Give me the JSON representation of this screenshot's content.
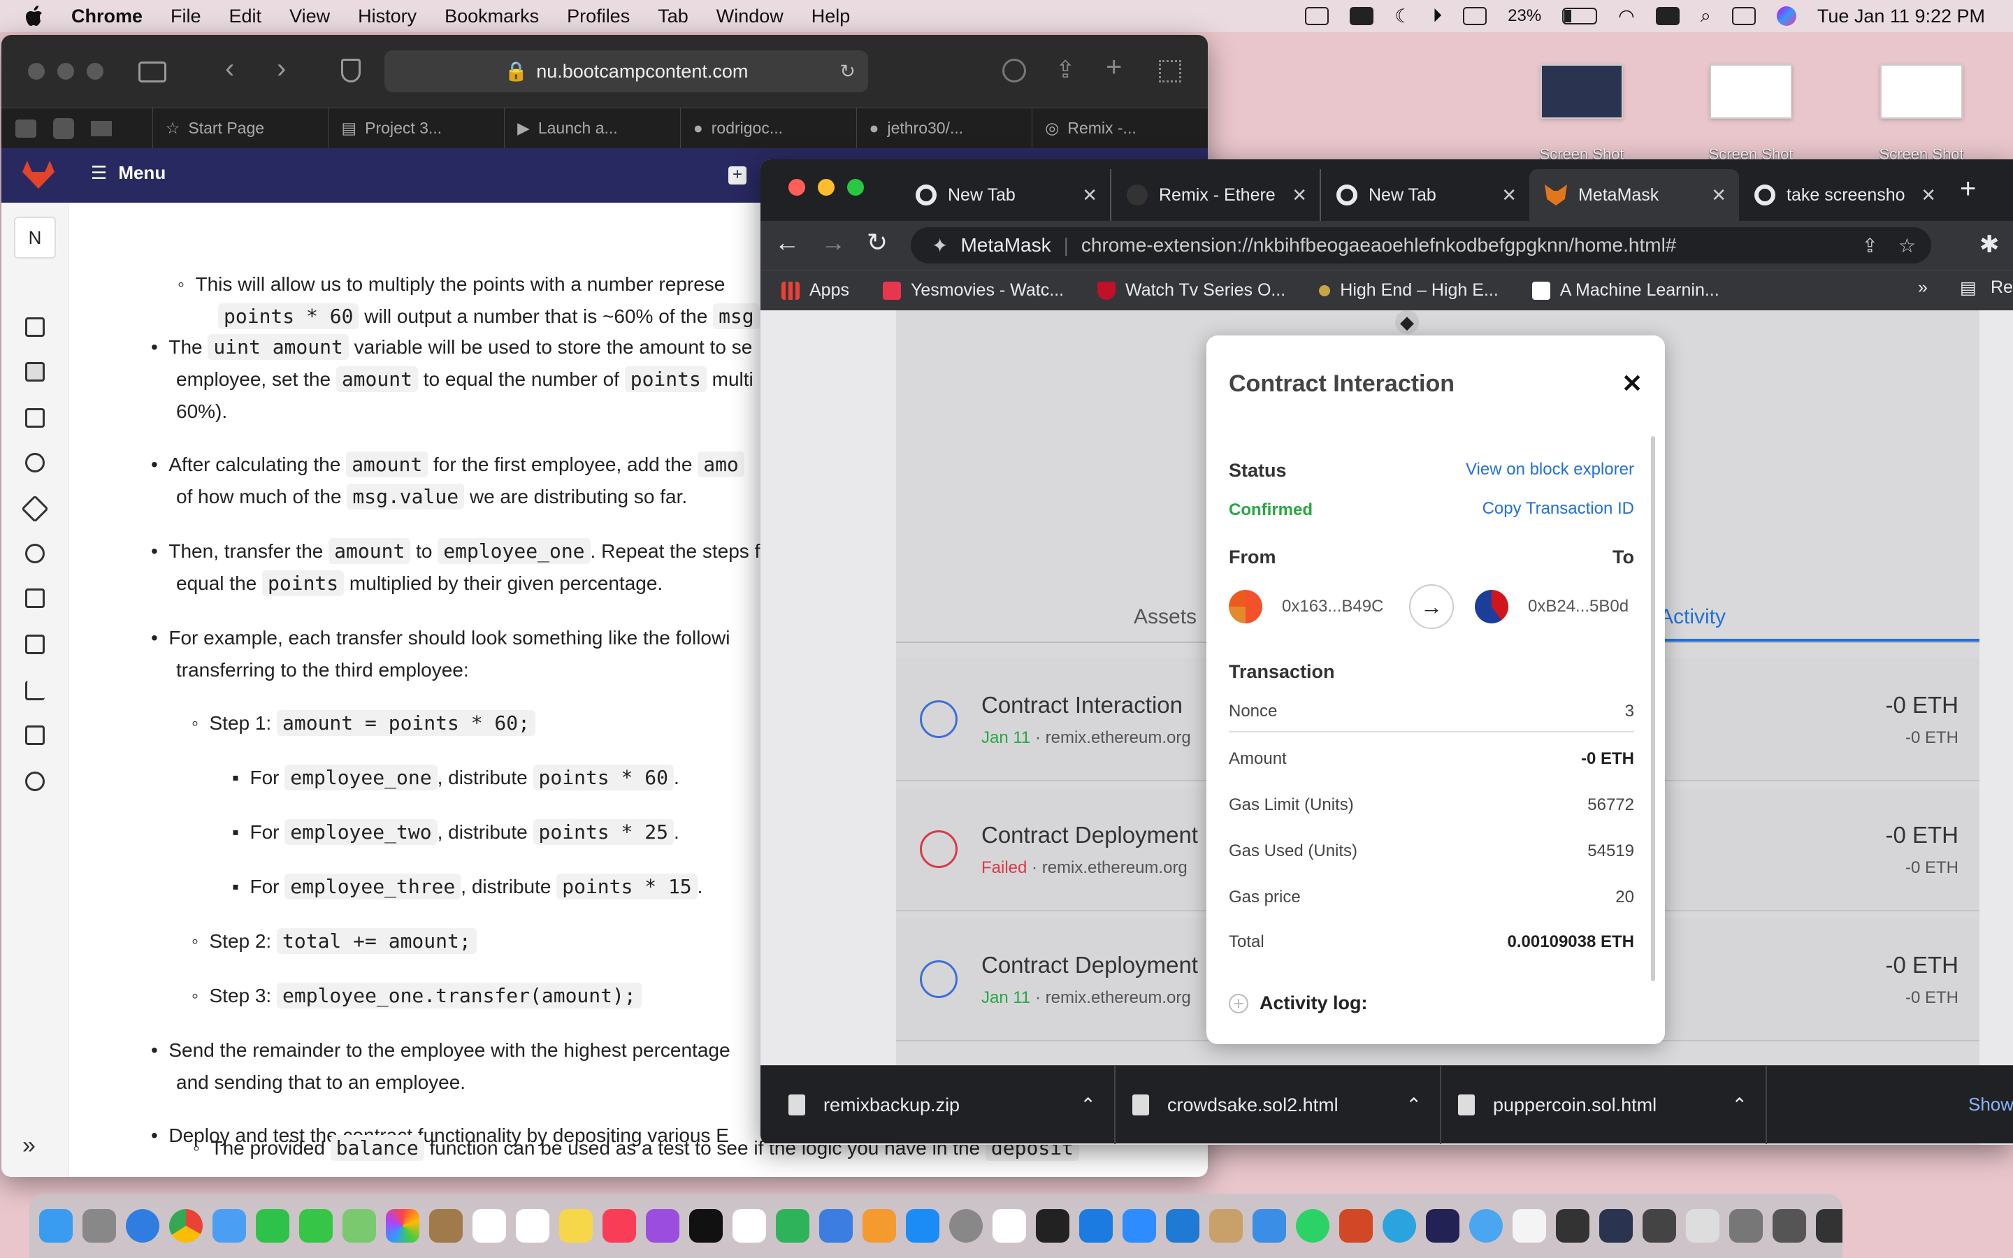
{
  "menubar": {
    "app": "Chrome",
    "items": [
      "File",
      "Edit",
      "View",
      "History",
      "Bookmarks",
      "Profiles",
      "Tab",
      "Window",
      "Help"
    ],
    "battery": "23%",
    "datetime": "Tue Jan 11  9:22 PM"
  },
  "desktop": {
    "thumb_caption": "Screen Shot"
  },
  "safari": {
    "url": "nu.bootcampcontent.com",
    "tabs": [
      "Start Page",
      "Project 3...",
      "Launch a...",
      "rodrigoc...",
      "jethro30/...",
      "Remix -..."
    ],
    "gitlab_menu": "Menu",
    "sidebar_letter": "N"
  },
  "doc": {
    "p1a": "This will allow us to multiply the points with a number represe",
    "p1b_code": "points * 60",
    "p1b_text": " will output a number that is ~60% of the ",
    "p1b_code2": "msg",
    "p2_a": "The ",
    "p2_code": "uint amount",
    "p2_b": " variable will be used to store the amount to se",
    "p2_c": "employee, set the ",
    "p2_code2": "amount",
    "p2_d": " to equal the number of ",
    "p2_code3": "points",
    "p2_e": " multi",
    "p2_f": "60%).",
    "p3_a": "After calculating the ",
    "p3_code": "amount",
    "p3_b": " for the first employee, add the ",
    "p3_code2": "amo",
    "p3_c": "of how much of the ",
    "p3_code3": "msg.value",
    "p3_d": " we are distributing so far.",
    "p4_a": "Then, transfer the ",
    "p4_code": "amount",
    "p4_b": " to ",
    "p4_code2": "employee_one",
    "p4_c": ". Repeat the steps f",
    "p4_d": "equal the ",
    "p4_code3": "points",
    "p4_e": " multiplied by their given percentage.",
    "p5_a": "For example, each transfer should look something like the followi",
    "p5_b": "transferring to the third employee:",
    "step1": "Step 1: ",
    "step1_code": "amount = points * 60;",
    "for1": "For ",
    "e1": "employee_one",
    "dist": ", distribute ",
    "c1": "points * 60",
    "e2": "employee_two",
    "c2": "points * 25",
    "e3": "employee_three",
    "c3": "points * 15",
    "dot": ".",
    "step2": "Step 2: ",
    "step2_code": "total += amount;",
    "step3": "Step 3: ",
    "step3_code": "employee_one.transfer(amount);",
    "p6_a": "Send the remainder to the employee with the highest percentage",
    "p6_b": "and sending that to an employee.",
    "p7": "Deploy and test the contract functionality by depositing various E",
    "p8_a": "The provided ",
    "p8_code": "balance",
    "p8_b": " function can be used as a test to see if the logic you have in the ",
    "p8_code2": "deposit"
  },
  "chrome": {
    "tabs": [
      "New Tab",
      "Remix - Ethere",
      "New Tab",
      "MetaMask",
      "take screensho"
    ],
    "url_label": "MetaMask",
    "url": "chrome-extension://nkbihfbeogaeaoehlefnkodbefgpgknn/home.html#",
    "bookmarks": [
      "Apps",
      "Yesmovies - Watc...",
      "Watch Tv Series O...",
      "High End – High E...",
      "A Machine Learnin..."
    ],
    "bookmarks_more": "»",
    "bookmarks_right": "Re"
  },
  "metamask": {
    "tab_assets": "Assets",
    "tab_activity": "Activity",
    "activities": [
      {
        "title": "Contract Interaction",
        "status": "Jan 11",
        "site": "remix.ethereum.org",
        "amount": "-0 ETH",
        "sub": "-0 ETH",
        "failed": false
      },
      {
        "title": "Contract Deployment",
        "status": "Failed",
        "site": "remix.ethereum.org",
        "amount": "-0 ETH",
        "sub": "-0 ETH",
        "failed": true
      },
      {
        "title": "Contract Deployment",
        "status": "Jan 11",
        "site": "remix.ethereum.org",
        "amount": "-0 ETH",
        "sub": "-0 ETH",
        "failed": false
      }
    ]
  },
  "popup": {
    "title": "Contract Interaction",
    "status_label": "Status",
    "status_value": "Confirmed",
    "explorer": "View on block explorer",
    "copy_tx": "Copy Transaction ID",
    "from_label": "From",
    "to_label": "To",
    "from_addr": "0x163...B49C",
    "to_addr": "0xB24...5B0d",
    "transaction_label": "Transaction",
    "rows": [
      {
        "label": "Nonce",
        "value": "3"
      },
      {
        "label": "Amount",
        "value": "-0 ETH"
      },
      {
        "label": "Gas Limit (Units)",
        "value": "56772"
      },
      {
        "label": "Gas Used (Units)",
        "value": "54519"
      },
      {
        "label": "Gas price",
        "value": "20"
      },
      {
        "label": "Total",
        "value": "0.00109038 ETH"
      }
    ],
    "activity_log": "Activity log:"
  },
  "downloads": {
    "files": [
      "remixbackup.zip",
      "crowdsake.sol2.html",
      "puppercoin.sol.html"
    ],
    "show_all": "Show"
  },
  "colors": {
    "gitlab_header": "#292961",
    "confirmed": "#28a745",
    "failed": "#d73a49",
    "link": "#2470d6"
  }
}
